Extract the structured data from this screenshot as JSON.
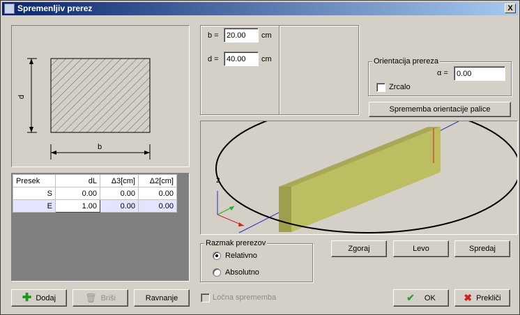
{
  "window": {
    "title": "Spremenljiv prerez",
    "close_label": "X"
  },
  "section_drawing": {
    "dim_d": "d",
    "dim_b": "b"
  },
  "dims": {
    "b_label": "b =",
    "b_value": "20.00",
    "b_unit": "cm",
    "d_label": "d =",
    "d_value": "40.00",
    "d_unit": "cm"
  },
  "orientation": {
    "group_label": "Orientacija prereza",
    "alpha_label": "α =",
    "alpha_value": "0.00",
    "mirror_label": "Zrcalo",
    "mirror_checked": false
  },
  "change_orientation_button": "Sprememba orientacije palice",
  "viewport": {
    "axis_label": "2"
  },
  "table": {
    "headers": [
      "Presek",
      "dL",
      "Δ3[cm]",
      "Δ2[cm]"
    ],
    "rows": [
      {
        "name": "S",
        "dL": "0.00",
        "d3": "0.00",
        "d2": "0.00"
      },
      {
        "name": "E",
        "dL": "1.00",
        "d3": "0.00",
        "d2": "0.00"
      }
    ]
  },
  "spacing": {
    "group_label": "Razmak prerezov",
    "relative_label": "Relativno",
    "absolute_label": "Absolutno",
    "selected": "Relativno"
  },
  "view_buttons": {
    "top": "Zgoraj",
    "left": "Levo",
    "front": "Spredaj"
  },
  "toolbar": {
    "add_label": "Dodaj",
    "delete_label": "Briši",
    "align_label": "Ravnanje",
    "arc_label": "Ločna sprememba",
    "ok_label": "OK",
    "cancel_label": "Prekliči"
  },
  "colors": {
    "beam": "#bdbd62",
    "title_start": "#0a246a",
    "title_end": "#a6caf0",
    "annotation": "#000000"
  }
}
